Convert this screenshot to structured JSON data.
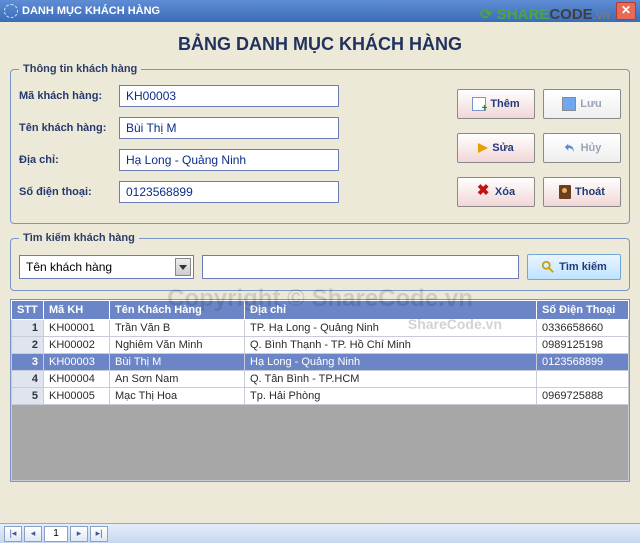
{
  "window": {
    "title": "DANH MỤC KHÁCH HÀNG"
  },
  "brand": {
    "name": "SHARECODE",
    "tld": ".vn",
    "watermark_center": "Copyright © ShareCode.vn",
    "watermark_search": "ShareCode.vn"
  },
  "heading": "BẢNG DANH MỤC KHÁCH HÀNG",
  "infoGroup": {
    "legend": "Thông tin khách hàng",
    "labels": {
      "customer_id": "Mã khách hàng:",
      "customer_name": "Tên khách hàng:",
      "address": "Địa chỉ:",
      "phone": "Số điện thoại:"
    },
    "values": {
      "customer_id": "KH00003",
      "customer_name": "Bùi Thị M",
      "address": "Hạ Long - Quảng Ninh",
      "phone": "0123568899"
    }
  },
  "buttons": {
    "add": "Thêm",
    "save": "Lưu",
    "edit": "Sửa",
    "cancel": "Hủy",
    "delete": "Xóa",
    "exit": "Thoát"
  },
  "searchGroup": {
    "legend": "Tìm kiếm khách hàng",
    "combo_selected": "Tên khách hàng",
    "input_value": "",
    "input_placeholder": "",
    "button": "Tìm kiếm"
  },
  "table": {
    "headers": {
      "stt": "STT",
      "makh": "Mã KH",
      "ten": "Tên Khách Hàng",
      "diachi": "Địa chỉ",
      "sdt": "Số Điện Thoại"
    },
    "rows": [
      {
        "stt": 1,
        "makh": "KH00001",
        "ten": "Trần Văn B",
        "diachi": "TP. Hạ Long - Quảng Ninh",
        "sdt": "0336658660",
        "selected": false
      },
      {
        "stt": 2,
        "makh": "KH00002",
        "ten": "Nghiêm Văn Minh",
        "diachi": "Q. Bình Thạnh - TP. Hồ Chí Minh",
        "sdt": "0989125198",
        "selected": false
      },
      {
        "stt": 3,
        "makh": "KH00003",
        "ten": "Bùi Thị M",
        "diachi": "Hạ Long - Quảng Ninh",
        "sdt": "0123568899",
        "selected": true
      },
      {
        "stt": 4,
        "makh": "KH00004",
        "ten": "An Sơn Nam",
        "diachi": "Q. Tân Bình - TP.HCM",
        "sdt": "",
        "selected": false
      },
      {
        "stt": 5,
        "makh": "KH00005",
        "ten": "Mạc Thị Hoa",
        "diachi": "Tp. Hải Phòng",
        "sdt": "0969725888",
        "selected": false
      }
    ]
  },
  "pager": {
    "current": "1"
  }
}
